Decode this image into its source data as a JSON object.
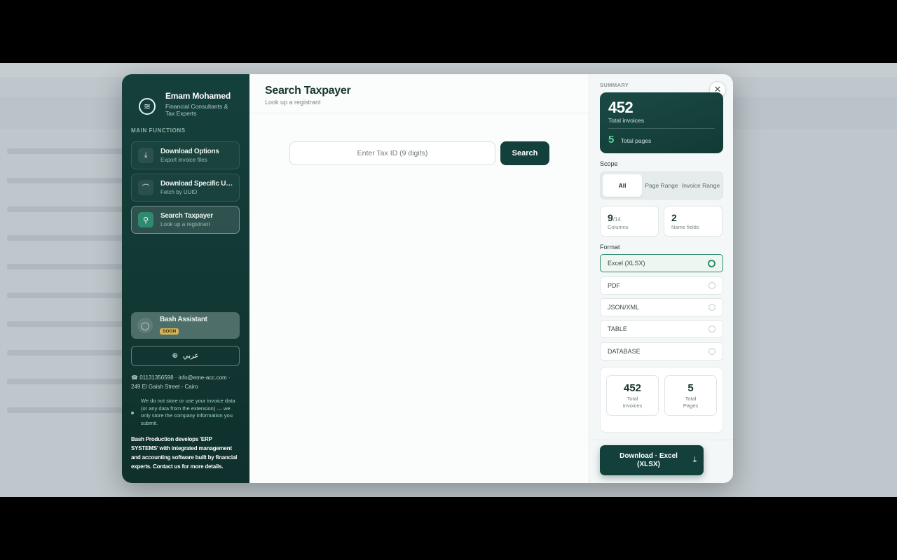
{
  "sidebar": {
    "brand_name": "Emam Mohamed",
    "brand_sub": "Financial Consultants & Tax Experts",
    "section_label": "MAIN FUNCTIONS",
    "items": [
      {
        "title": "Download Options",
        "sub": "Export invoice files",
        "icon": "download-icon"
      },
      {
        "title": "Download Specific UUI...",
        "sub": "Fetch by UUID",
        "icon": "fingerprint-icon"
      },
      {
        "title": "Search Taxpayer",
        "sub": "Look up a registrant",
        "icon": "user-search-icon"
      }
    ],
    "assistant": {
      "title": "Bash Assistant",
      "badge": "SOON",
      "icon": "chat-icon"
    },
    "lang_button": "عربي",
    "contact_line1": "☎ 01131356598 · info@eme-acc.com ·",
    "contact_line2": "249 El Gaish Street - Cairo",
    "privacy": "We do not store or use your invoice data (or any data from the extension) — we only store the company information you submit.",
    "promo": "Bash Production develops 'ERP SYSTEMS' with integrated management and accounting software built by financial experts. Contact us for more details."
  },
  "main": {
    "title": "Search Taxpayer",
    "subtitle": "Look up a registrant",
    "search_placeholder": "Enter Tax ID (9 digits)",
    "search_button": "Search"
  },
  "right": {
    "summary_label": "SUMMARY",
    "total_invoices": "452",
    "total_invoices_label": "Total invoices",
    "total_pages": "5",
    "total_pages_label": "Total pages",
    "scope_label": "Scope",
    "scope_options": [
      "All",
      "Page Range",
      "Invoice Range"
    ],
    "scope_selected": "All",
    "columns_n": "9",
    "columns_total": "/14",
    "columns_label": "Columns",
    "name_fields_n": "2",
    "name_fields_label": "Name fields",
    "format_label": "Format",
    "formats": [
      "Excel (XLSX)",
      "PDF",
      "JSON/XML",
      "TABLE",
      "DATABASE"
    ],
    "format_selected": "Excel (XLSX)",
    "stat_invoices_n": "452",
    "stat_invoices_label": "Total Invoices",
    "stat_pages_n": "5",
    "stat_pages_label": "Total Pages",
    "download_button": "Download · Excel (XLSX)"
  },
  "colors": {
    "primary": "#14403b",
    "accent": "#2f8a6f",
    "highlight": "#5fd39e",
    "badge": "#d9b55a"
  }
}
